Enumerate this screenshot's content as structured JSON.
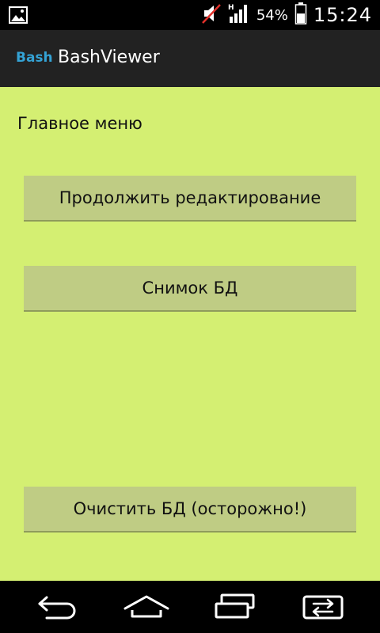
{
  "status_bar": {
    "battery_percent": "54%",
    "time": "15:24",
    "network_type": "H",
    "icons": [
      "gallery-icon",
      "mute-icon",
      "signal-icon",
      "battery-icon"
    ],
    "battery_level": 0.54
  },
  "action_bar": {
    "logo_text": "Bash",
    "title": "BashViewer"
  },
  "main": {
    "heading": "Главное меню",
    "buttons": [
      {
        "label": "Продолжить редактирование"
      },
      {
        "label": "Снимок БД"
      },
      {
        "label": "Очистить БД (осторожно!)"
      }
    ]
  },
  "nav_bar": {
    "icons": [
      "back-icon",
      "home-icon",
      "recent-apps-icon",
      "switch-window-icon"
    ]
  },
  "colors": {
    "background": "#d4ef72",
    "button": "#bfcc84",
    "action_bar": "#222222",
    "logo": "#34a2d4"
  }
}
